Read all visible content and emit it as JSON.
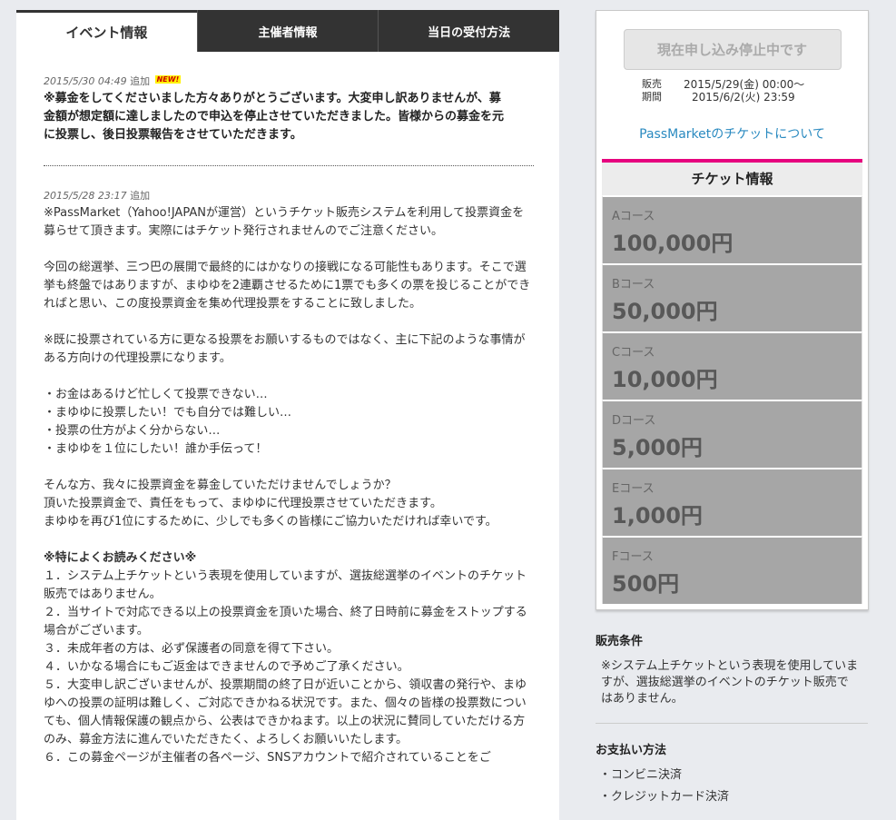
{
  "tabs": [
    {
      "label": "イベント情報"
    },
    {
      "label": "主催者情報"
    },
    {
      "label": "当日の受付方法"
    }
  ],
  "posts": [
    {
      "date": "2015/5/30 04:49",
      "suffix": "追加",
      "badge": "NEW!",
      "text": "※募金をしてくださいました方々ありがとうございます。大変申し訳ありませんが、募金額が想定額に達しましたので申込を停止させていただきました。皆様からの募金を元に投票し、後日投票報告をさせていただきます。"
    },
    {
      "date": "2015/5/28 23:17",
      "suffix": "追加",
      "p1": "※PassMarket（Yahoo!JAPANが運営）というチケット販売システムを利用して投票資金を募らせて頂きます。実際にはチケット発行されませんのでご注意ください。",
      "p2": "今回の総選挙、三つ巴の展開で最終的にはかなりの接戦になる可能性もあります。そこで選挙も終盤ではありますが、まゆゆを2連覇させるために1票でも多くの票を投じることができればと思い、この度投票資金を集め代理投票をすることに致しました。",
      "p3": "※既に投票されている方に更なる投票をお願いするものではなく、主に下記のような事情がある方向けの代理投票になります。",
      "bullets": [
        "・お金はあるけど忙しくて投票できない…",
        "・まゆゆに投票したい！でも自分では難しい…",
        "・投票の仕方がよく分からない…",
        "・まゆゆを１位にしたい！誰か手伝って！"
      ],
      "p4_lines": [
        "そんな方、我々に投票資金を募金していただけませんでしょうか？",
        "頂いた投票資金で、責任をもって、まゆゆに代理投票させていただきます。",
        "まゆゆを再び1位にするために、少しでも多くの皆様にご協力いただければ幸いです。"
      ],
      "notes_title": "※特によくお読みください※",
      "notes": [
        "１．システム上チケットという表現を使用していますが、選抜総選挙のイベントのチケット販売ではありません。",
        "２．当サイトで対応できる以上の投票資金を頂いた場合、終了日時前に募金をストップする場合がございます。",
        "３．未成年者の方は、必ず保護者の同意を得て下さい。",
        "４．いかなる場合にもご返金はできませんので予めご了承ください。",
        "５．大変申し訳ございませんが、投票期間の終了日が近いことから、領収書の発行や、まゆゆへの投票の証明は難しく、ご対応できかねる状況です。また、個々の皆様の投票数についても、個人情報保護の観点から、公表はできかねます。以上の状況に賛同していただける方のみ、募金方法に進んでいただきたく、よろしくお願いいたします。",
        "６．この募金ページが主催者の各ページ、SNSアカウントで紹介されていることをご"
      ]
    }
  ],
  "sidebar": {
    "stop_button": "現在申し込み停止中です",
    "period_label_1": "販売",
    "period_label_2": "期間",
    "period_start": "2015/5/29(金) 00:00～",
    "period_end": "2015/6/2(火) 23:59",
    "pass_link": "PassMarketのチケットについて",
    "ticket_info_title": "チケット情報",
    "courses": [
      {
        "name": "Aコース",
        "price": "100,000円"
      },
      {
        "name": "Bコース",
        "price": "50,000円"
      },
      {
        "name": "Cコース",
        "price": "10,000円"
      },
      {
        "name": "Dコース",
        "price": "5,000円"
      },
      {
        "name": "Eコース",
        "price": "1,000円"
      },
      {
        "name": "Fコース",
        "price": "500円"
      }
    ],
    "conditions_title": "販売条件",
    "conditions_text": "※システム上チケットという表現を使用していますが、選抜総選挙のイベントのチケット販売ではありません。",
    "payment_title": "お支払い方法",
    "payment_methods": [
      "・コンビニ決済",
      "・クレジットカード決済"
    ]
  },
  "colors": {
    "accent": "#e6007e",
    "tab_bar": "#333333",
    "link": "#2a8ac0",
    "course_bg": "#a6a6a6"
  }
}
